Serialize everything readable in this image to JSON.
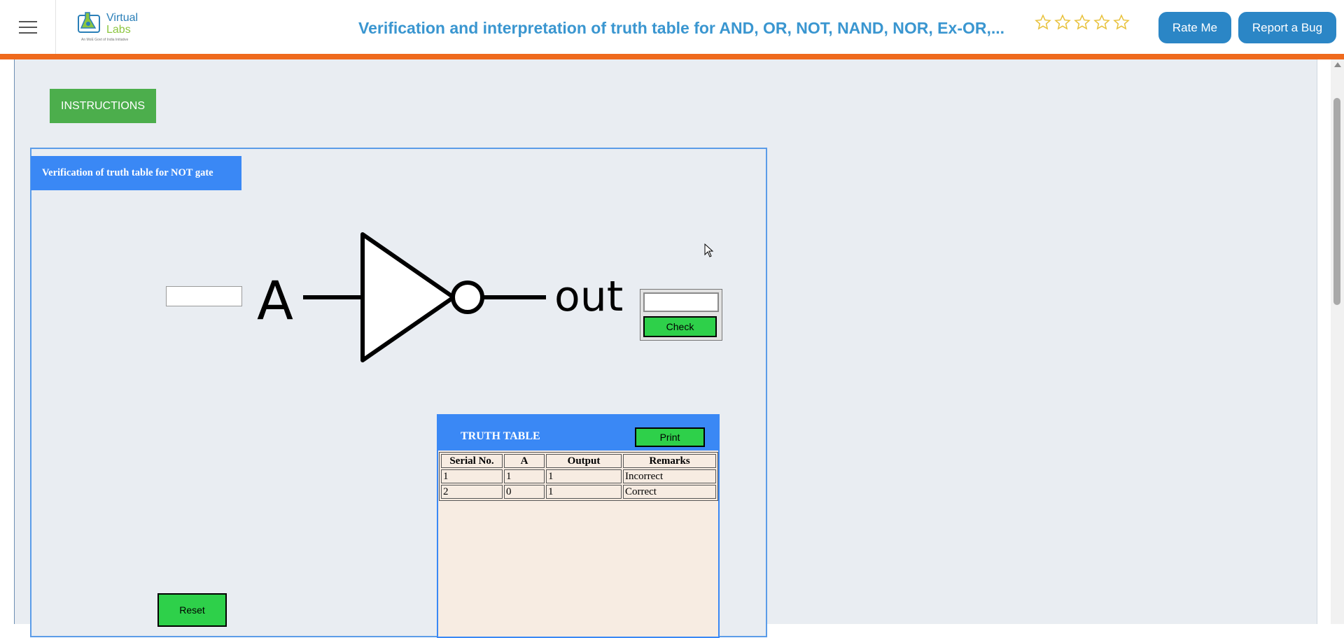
{
  "header": {
    "logo_line1": "Virtual",
    "logo_line2": "Labs",
    "logo_subtitle": "An MoE Govt of India Initiative",
    "title": "Verification and interpretation of truth table for AND, OR, NOT, NAND, NOR, Ex-OR,...",
    "rating_stars": 5,
    "rate_button": "Rate Me",
    "bug_button": "Report a Bug",
    "accent_color": "#ef6a1d",
    "title_color": "#3a96d0"
  },
  "instructions_button": "INSTRUCTIONS",
  "simulation": {
    "title": "Verification of truth table for NOT gate",
    "input_label": "A",
    "output_label": "out",
    "input_value": "",
    "output_value": "",
    "check_button": "Check",
    "reset_button": "Reset"
  },
  "truth_table": {
    "title": "TRUTH TABLE",
    "print_button": "Print",
    "columns": [
      "Serial No.",
      "A",
      "Output",
      "Remarks"
    ],
    "rows": [
      [
        "1",
        "1",
        "1",
        "Incorrect"
      ],
      [
        "2",
        "0",
        "1",
        "Correct"
      ]
    ]
  }
}
